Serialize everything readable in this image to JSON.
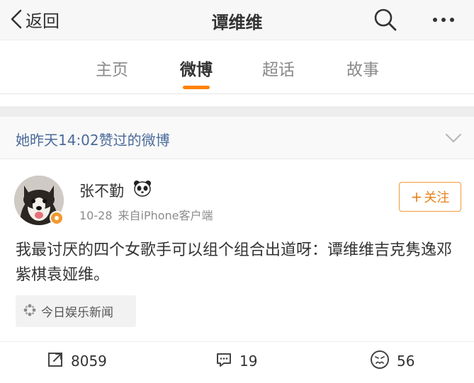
{
  "header": {
    "back_label": "返回",
    "title": "谭维维",
    "icons": [
      "chevron-left-icon",
      "search-icon",
      "more-icon"
    ]
  },
  "tabs": [
    {
      "label": "主页",
      "active": false
    },
    {
      "label": "微博",
      "active": true
    },
    {
      "label": "超话",
      "active": false
    },
    {
      "label": "故事",
      "active": false
    }
  ],
  "liked_header": {
    "text": "她昨天14:02赞过的微博"
  },
  "post": {
    "username": "张不勤",
    "date": "10-28",
    "source": "来自iPhone客户端",
    "follow_label": "关注",
    "text": "我最讨厌的四个女歌手可以组个组合出道呀：谭维维吉克隽逸邓紫棋袁娅维。",
    "topic": "今日娱乐新闻",
    "actions": {
      "repost": "8059",
      "comment": "19",
      "like": "56"
    }
  },
  "colors": {
    "accent": "#ff8200",
    "follow": "#e8801a",
    "liked_text": "#4a6a9a"
  }
}
